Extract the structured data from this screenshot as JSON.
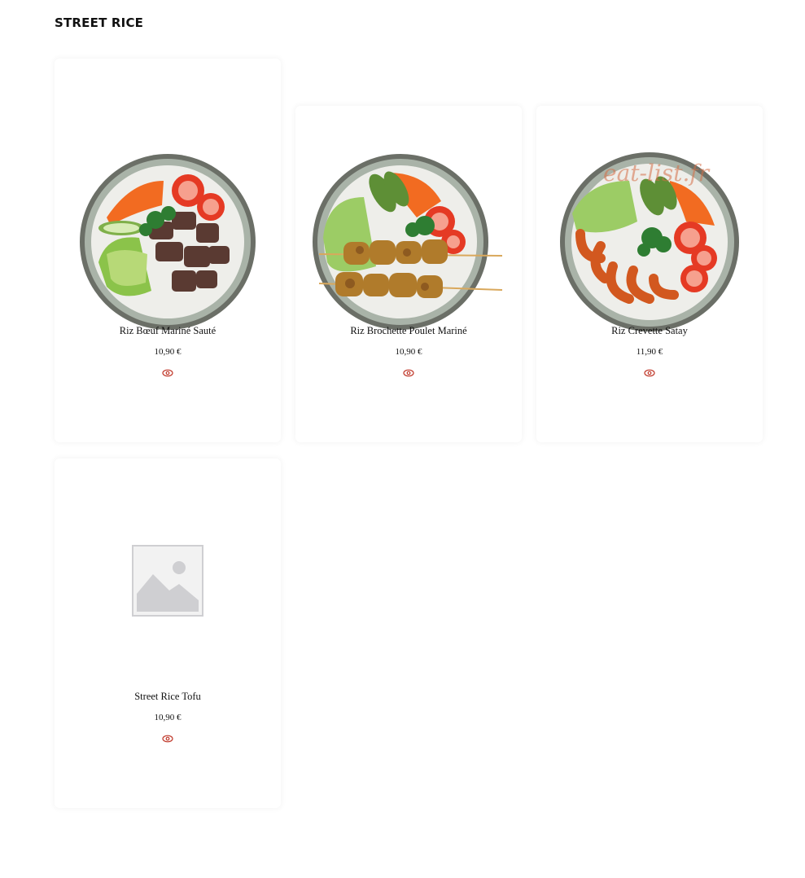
{
  "section": {
    "title": "STREET RICE"
  },
  "products": [
    {
      "name": "Riz Bœuf Mariné Sauté",
      "price": "10,90 €",
      "image_icon": "bowl-beef-photo"
    },
    {
      "name": "Riz Brochette Poulet Mariné",
      "price": "10,90 €",
      "image_icon": "bowl-chicken-skewer-photo"
    },
    {
      "name": "Riz Crevette Satay",
      "price": "11,90 €",
      "image_icon": "bowl-shrimp-photo"
    },
    {
      "name": "Street Rice Tofu",
      "price": "10,90 €",
      "image_icon": "image-placeholder-icon"
    }
  ],
  "watermark": "eat-list.fr",
  "colors": {
    "accent": "#c0392b",
    "background": "#ffffff",
    "text": "#111111"
  }
}
